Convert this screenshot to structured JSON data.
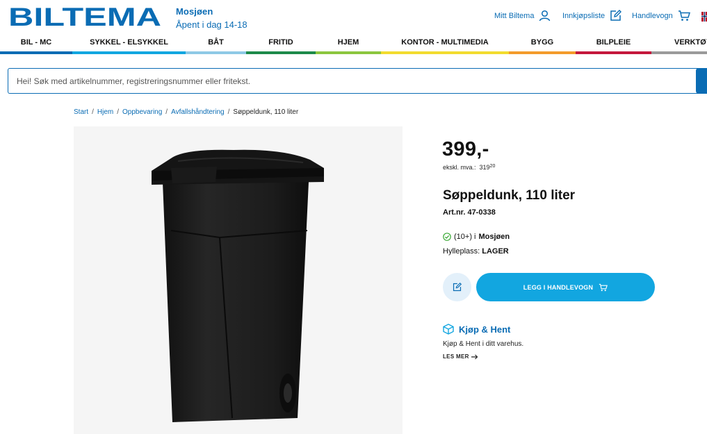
{
  "brand": {
    "logo_text": "BILTEMA"
  },
  "store": {
    "name": "Mosjøen",
    "hours": "Åpent i dag 14-18"
  },
  "header_links": {
    "account": "Mitt Biltema",
    "shopping_list": "Innkjøpsliste",
    "cart": "Handlevogn"
  },
  "nav": {
    "items": [
      {
        "label": "BIL - MC",
        "color": "#0a6cb4"
      },
      {
        "label": "SYKKEL - ELSYKKEL",
        "color": "#12a6e0"
      },
      {
        "label": "BÅT",
        "color": "#8ec9e6"
      },
      {
        "label": "FRITID",
        "color": "#1d8a4a"
      },
      {
        "label": "HJEM",
        "color": "#8cc63f"
      },
      {
        "label": "KONTOR - MULTIMEDIA",
        "color": "#f2dc2f"
      },
      {
        "label": "BYGG",
        "color": "#f39b2b"
      },
      {
        "label": "BILPLEIE",
        "color": "#c4183c"
      },
      {
        "label": "VERKTØY",
        "color": "#9a9a9a"
      }
    ]
  },
  "search": {
    "placeholder": "Hei! Søk med artikelnummer, registreringsnummer eller fritekst."
  },
  "breadcrumb": {
    "items": [
      "Start",
      "Hjem",
      "Oppbevaring",
      "Avfallshåndtering"
    ],
    "current": "Søppeldunk, 110 liter"
  },
  "product": {
    "price": "399,-",
    "excl_label": "ekskl. mva.:",
    "excl_value": "319",
    "excl_decimals": "20",
    "title": "Søppeldunk, 110 liter",
    "article": "Art.nr. 47-0338",
    "stock_count": "(10+) i",
    "stock_store": "Mosjøen",
    "shelf_label": "Hylleplass:",
    "shelf_value": "LAGER",
    "add_to_cart": "LEGG I HANDLEVOGN"
  },
  "click_collect": {
    "title": "Kjøp & Hent",
    "text": "Kjøp & Hent i ditt varehus.",
    "read_more": "LES MER"
  },
  "colors": {
    "brand_blue": "#0a6cb4",
    "cta_blue": "#12a6e0",
    "stock_green": "#3aa935"
  }
}
